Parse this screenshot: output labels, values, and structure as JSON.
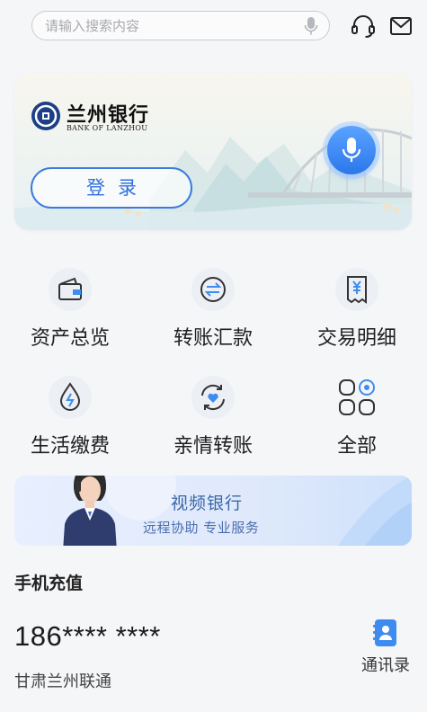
{
  "search": {
    "placeholder": "请输入搜索内容"
  },
  "icons": {
    "mic": "mic-icon",
    "headset": "headset-icon",
    "mail": "mail-icon",
    "voice": "microphone-icon"
  },
  "banner": {
    "logo_text": "兰州银行",
    "logo_sub": "BANK OF LANZHOU",
    "login_label": "登录"
  },
  "menu": [
    {
      "label": "资产总览",
      "icon": "wallet-icon"
    },
    {
      "label": "转账汇款",
      "icon": "transfer-icon"
    },
    {
      "label": "交易明细",
      "icon": "receipt-icon"
    },
    {
      "label": "生活缴费",
      "icon": "water-drop-icon"
    },
    {
      "label": "亲情转账",
      "icon": "heart-exchange-icon"
    },
    {
      "label": "全部",
      "icon": "apps-icon"
    }
  ],
  "video_banner": {
    "title": "视频银行",
    "subtitle": "远程协助  专业服务"
  },
  "recharge": {
    "title": "手机充值",
    "phone": "186**** ****",
    "carrier": "甘肃兰州联通",
    "contacts_label": "通讯录"
  },
  "colors": {
    "accent": "#2f6fe0",
    "icon_bg": "#eceff4",
    "icon_stroke": "#333333"
  }
}
